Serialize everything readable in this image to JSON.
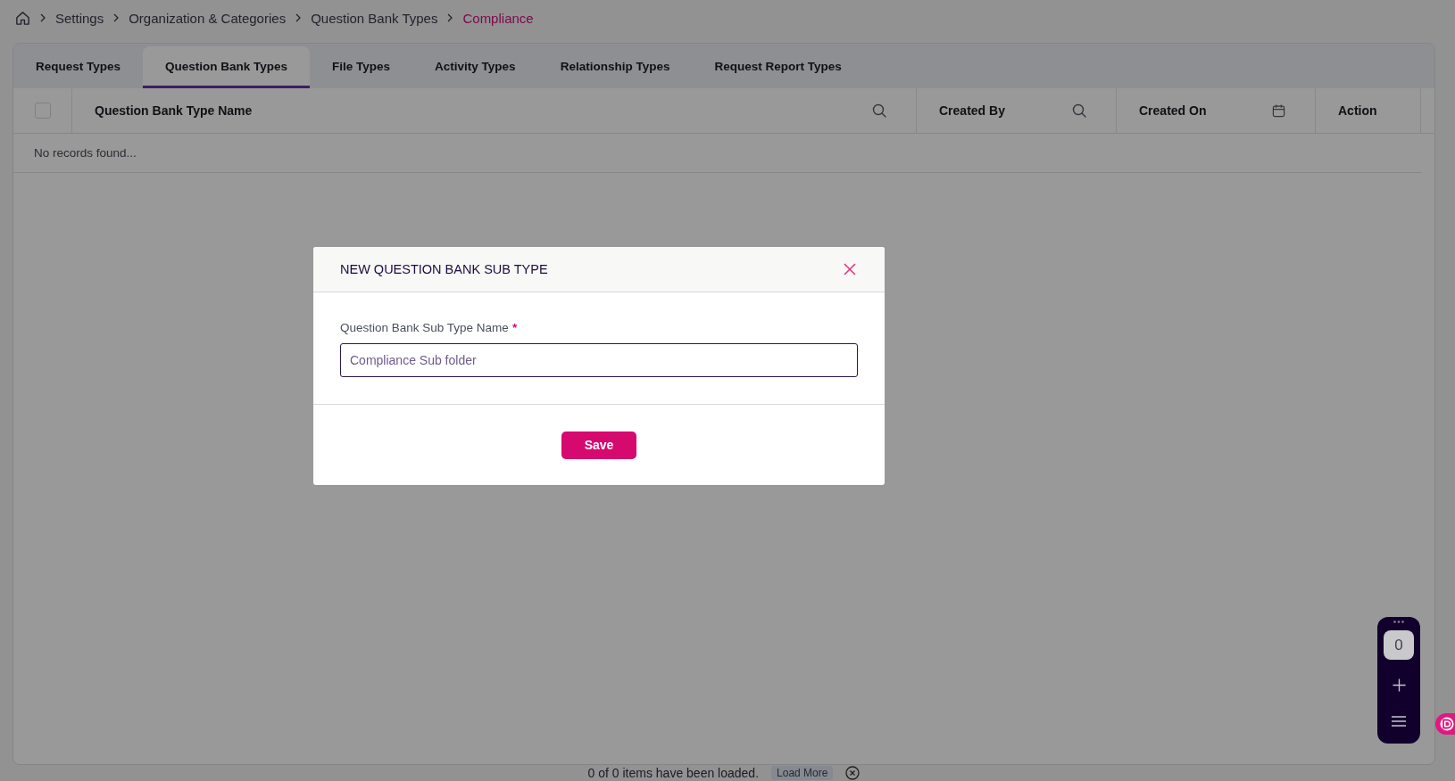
{
  "breadcrumb": [
    {
      "label": "Settings",
      "current": false
    },
    {
      "label": "Organization & Categories",
      "current": false
    },
    {
      "label": "Question Bank Types",
      "current": false
    },
    {
      "label": "Compliance",
      "current": true
    }
  ],
  "tabs": [
    {
      "label": "Request Types",
      "selected": false
    },
    {
      "label": "Question Bank Types",
      "selected": true
    },
    {
      "label": "File Types",
      "selected": false
    },
    {
      "label": "Activity Types",
      "selected": false
    },
    {
      "label": "Relationship Types",
      "selected": false
    },
    {
      "label": "Request Report Types",
      "selected": false
    }
  ],
  "table": {
    "select_all_checked": false,
    "columns": [
      {
        "label": "Question Bank Type Name",
        "kind": "search"
      },
      {
        "label": "Created By",
        "kind": "search"
      },
      {
        "label": "Created On",
        "kind": "date"
      },
      {
        "label": "Action",
        "kind": "plain"
      }
    ],
    "empty_message": "No records found..."
  },
  "footer": {
    "status": "0 of 0 items have been loaded.",
    "load_more": {
      "label": "Load More",
      "disabled": true
    }
  },
  "dialog": {
    "title": "NEW QUESTION BANK SUB TYPE",
    "field": {
      "label": "Question Bank Sub Type Name",
      "required_mark": "*",
      "value": "Compliance Sub folder"
    },
    "button": "Save"
  },
  "widget": {
    "count": "0"
  }
}
